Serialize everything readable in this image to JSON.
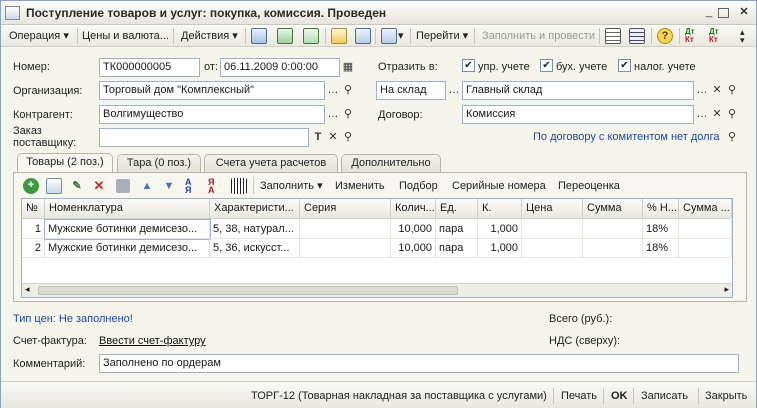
{
  "window": {
    "title": "Поступление товаров и услуг: покупка, комиссия. Проведен"
  },
  "toolbar": {
    "operation": "Операция",
    "prices": "Цены и валюта...",
    "actions": "Действия",
    "goto": "Перейти",
    "fill_and_post": "Заполнить и провести"
  },
  "header": {
    "number_label": "Номер:",
    "number_value": "ТК000000005",
    "date_label": "от:",
    "date_value": "06.11.2009  0:00:00",
    "org_label": "Организация:",
    "org_value": "Торговый дом \"Комплексный\"",
    "contractor_label": "Контрагент:",
    "contractor_value": "Волгимущество",
    "order_label": "Заказ поставщику:",
    "order_value": "",
    "reflect_label": "Отразить в:",
    "chk_mgmt": "упр. учете",
    "chk_acc": "бух. учете",
    "chk_tax": "налог. учете",
    "warehouse_type": "На склад",
    "warehouse_value": "Главный склад",
    "contract_label": "Договор:",
    "contract_value": "Комиссия",
    "commission_link": "По договору с комитентом нет долга"
  },
  "tabs": [
    {
      "label": "Товары (2 поз.)"
    },
    {
      "label": "Тара (0 поз.)"
    },
    {
      "label": "Счета учета расчетов"
    },
    {
      "label": "Дополнительно"
    }
  ],
  "table_toolbar": {
    "fill": "Заполнить",
    "change": "Изменить",
    "selection": "Подбор",
    "serials": "Серийные номера",
    "revaluation": "Переоценка"
  },
  "table": {
    "columns": [
      "№",
      "Номенклатура",
      "Характеристи...",
      "Серия",
      "Колич...",
      "Ед.",
      "К.",
      "Цена",
      "Сумма",
      "% Н...",
      "Сумма ..."
    ],
    "rows": [
      [
        "1",
        "Мужские ботинки демисезо...",
        "5, 38, натурал...",
        "",
        "10,000",
        "пара",
        "1,000",
        "",
        "",
        "18%",
        ""
      ],
      [
        "2",
        "Мужские ботинки демисезо...",
        "5, 36, искусст...",
        "",
        "10,000",
        "пара",
        "1,000",
        "",
        "",
        "18%",
        ""
      ]
    ]
  },
  "footer": {
    "price_type": "Тип цен: Не заполнено!",
    "total_label": "Всего (руб.):",
    "invoice_label": "Счет-фактура:",
    "invoice_link": "Ввести счет-фактуру",
    "vat_label": "НДС (сверху):",
    "comment_label": "Комментарий:",
    "comment_value": "Заполнено по ордерам"
  },
  "statusbar": {
    "torg": "ТОРГ-12 (Товарная накладная за поставщика с услугами)",
    "print": "Печать",
    "ok": "OK",
    "save": "Записать",
    "close": "Закрыть"
  }
}
